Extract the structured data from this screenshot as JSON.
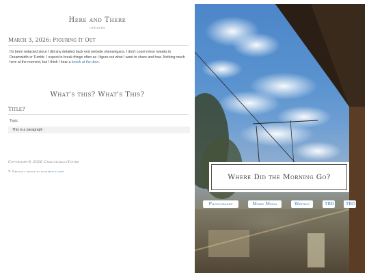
{
  "site": {
    "title": "Here and There",
    "subtitle": "updates"
  },
  "post": {
    "title": "March 3, 2026: Figuring It Out",
    "body_text": "It's been redacted since I did any detailed back end website shenanigans. I don't count minor tweaks to Dreamwidth or Tumblr. I expect to break things often as I figure out what I want to share and how. Nothing much here at the moment, but I think I hear a ",
    "link_text": "knock at the door",
    "body_end": "."
  },
  "about": {
    "heading": "What's this? What's This?",
    "section_title": "Title?",
    "topic_label": "Topic",
    "paragraph": "This is a paragraph",
    "paragraph_mark": "¹"
  },
  "footer": {
    "copyright": "Copyright© 2026 ChaoticallyYours",
    "design_prefix": "Original design by ",
    "design_link": "bluepencilgypsy"
  },
  "banner": {
    "title": "Where Did the Morning Go?"
  },
  "nav": {
    "items": [
      "Photography",
      "Mixed Media",
      "Writing",
      "TBD",
      "TBD"
    ]
  },
  "colors": {
    "link": "#3a7bb8",
    "text": "#444444",
    "rule": "#dddddd"
  }
}
